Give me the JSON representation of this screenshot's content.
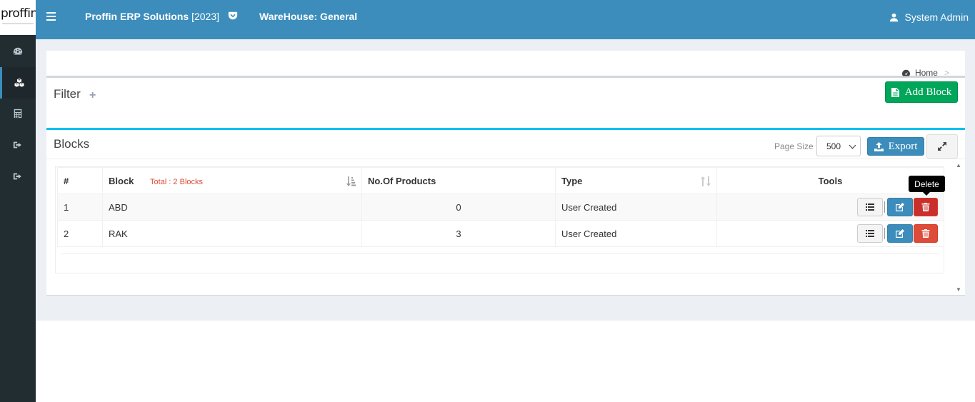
{
  "logo": {
    "text": "proffin"
  },
  "sidebar": {
    "items": [
      {
        "icon": "dashboard-icon"
      },
      {
        "icon": "cubes-icon",
        "active": true
      },
      {
        "icon": "calculator-icon"
      },
      {
        "icon": "sign-out-icon"
      },
      {
        "icon": "sign-out-icon"
      }
    ]
  },
  "header": {
    "app_name": "Proffin ERP Solutions",
    "year": "[2023]",
    "warehouse": "WareHouse: General",
    "user": "System Admin"
  },
  "breadcrumb": {
    "home": "Home",
    "separator": ">"
  },
  "filter": {
    "title": "Filter",
    "add_button": "Add Block"
  },
  "blocks": {
    "title": "Blocks",
    "page_size_label": "Page Size",
    "page_size_value": "500",
    "export_button": "Export",
    "columns": {
      "index": "#",
      "block": "Block",
      "total": "Total : 2 Blocks",
      "products": "No.Of Products",
      "type": "Type",
      "tools": "Tools"
    },
    "rows": [
      {
        "index": "1",
        "block": "ABD",
        "products": "0",
        "type": "User Created"
      },
      {
        "index": "2",
        "block": "RAK",
        "products": "3",
        "type": "User Created"
      }
    ]
  },
  "tooltip": {
    "text": "Delete"
  },
  "colors": {
    "header": "#3c8dbc",
    "sidebar": "#222d32",
    "success": "#00a65a",
    "danger": "#dd4b39",
    "info_line": "#00c0ef"
  }
}
